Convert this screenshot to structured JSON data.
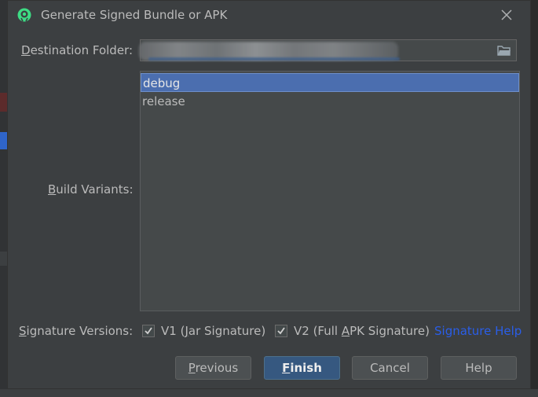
{
  "dialog": {
    "title": "Generate Signed Bundle or APK",
    "icon": "android-studio-icon",
    "close_icon": "close-icon"
  },
  "destination": {
    "label_underlined": "D",
    "label_rest": "estination Folder:",
    "value": "",
    "browse_icon": "folder-icon"
  },
  "build_variants": {
    "label_underlined": "B",
    "label_rest": "uild Variants:",
    "items": [
      {
        "label": "debug",
        "selected": true
      },
      {
        "label": "release",
        "selected": false
      }
    ]
  },
  "signature": {
    "label_underlined": "S",
    "label_rest": "ignature Versions:",
    "v1": {
      "label_pre": "V1 (",
      "label_underlined": "J",
      "label_post": "ar Signature)",
      "checked": true
    },
    "v2": {
      "label_pre": "V2 (Full ",
      "label_underlined": "A",
      "label_post": "PK Signature)",
      "checked": true
    },
    "help_link": "Signature Help"
  },
  "buttons": {
    "previous": {
      "underlined": "P",
      "rest": "revious"
    },
    "finish": {
      "underlined": "F",
      "rest": "inish"
    },
    "cancel": "Cancel",
    "help": "Help"
  },
  "colors": {
    "dialog_bg": "#3c3f41",
    "selection": "#4b6eaf",
    "default_button": "#365880",
    "link": "#2a5ee8"
  }
}
